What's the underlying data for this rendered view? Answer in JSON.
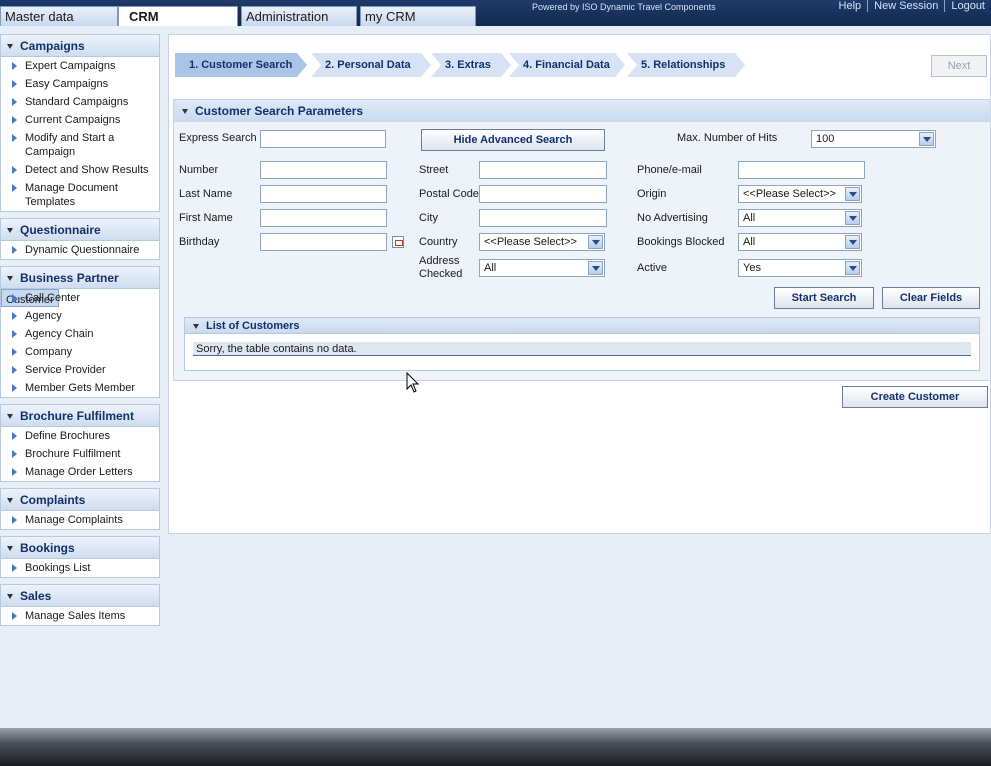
{
  "top_nav": {
    "tabs": [
      {
        "label": "Master data"
      },
      {
        "label": "CRM"
      },
      {
        "label": "Administration"
      },
      {
        "label": "my CRM"
      }
    ],
    "powered_by": "Powered by ISO Dynamic Travel Components",
    "links": [
      "Help",
      "New Session",
      "Logout"
    ]
  },
  "sidebar": {
    "sections": [
      {
        "title": "Campaigns",
        "items": [
          "Expert Campaigns",
          "Easy Campaigns",
          "Standard Campaigns",
          "Current Campaigns",
          "Modify and Start a Campaign",
          "Detect and Show Results",
          "Manage Document Templates"
        ]
      },
      {
        "title": "Questionnaire",
        "items": [
          "Dynamic Questionnaire"
        ]
      },
      {
        "title": "Business Partner",
        "items": [
          "Customer",
          "Call Center",
          "Agency",
          "Agency Chain",
          "Company",
          "Service Provider",
          "Member Gets Member"
        ]
      },
      {
        "title": "Brochure Fulfilment",
        "items": [
          "Define Brochures",
          "Brochure Fulfilment",
          "Manage Order Letters"
        ]
      },
      {
        "title": "Complaints",
        "items": [
          "Manage Complaints"
        ]
      },
      {
        "title": "Bookings",
        "items": [
          "Bookings List"
        ]
      },
      {
        "title": "Sales",
        "items": [
          "Manage Sales Items"
        ]
      }
    ]
  },
  "wizard": {
    "steps": [
      "1. Customer Search",
      "2. Personal Data",
      "3. Extras",
      "4. Financial Data",
      "5. Relationships"
    ],
    "next_label": "Next"
  },
  "search_panel": {
    "title": "Customer Search Parameters",
    "express_search_label": "Express Search",
    "hide_advanced_label": "Hide Advanced Search",
    "max_hits_label": "Max. Number of Hits",
    "max_hits_value": "100",
    "number_label": "Number",
    "last_name_label": "Last Name",
    "first_name_label": "First Name",
    "birthday_label": "Birthday",
    "street_label": "Street",
    "postal_code_label": "Postal Code",
    "city_label": "City",
    "country_label": "Country",
    "country_value": "<<Please Select>>",
    "address_checked_label": "Address Checked",
    "address_checked_value": "All",
    "phone_label": "Phone/e-mail",
    "origin_label": "Origin",
    "origin_value": "<<Please Select>>",
    "no_advertising_label": "No Advertising",
    "no_advertising_value": "All",
    "bookings_blocked_label": "Bookings Blocked",
    "bookings_blocked_value": "All",
    "active_label": "Active",
    "active_value": "Yes",
    "start_search_label": "Start Search",
    "clear_fields_label": "Clear Fields"
  },
  "customer_list": {
    "title": "List of Customers",
    "empty_message": "Sorry, the table contains no data."
  },
  "create_customer_label": "Create Customer"
}
